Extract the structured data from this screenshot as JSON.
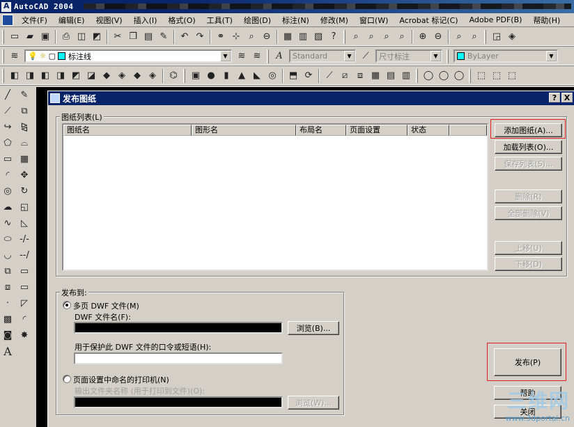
{
  "app": {
    "title": "AutoCAD 2004"
  },
  "menu": [
    "文件(F)",
    "编辑(E)",
    "视图(V)",
    "插入(I)",
    "格式(O)",
    "工具(T)",
    "绘图(D)",
    "标注(N)",
    "修改(M)",
    "窗口(W)",
    "Acrobat 标记(C)",
    "Adobe PDF(B)",
    "帮助(H)"
  ],
  "toolbar2": {
    "layer_value": "标注线",
    "text_style": "Standard",
    "dim_style": "尺寸标注",
    "color": "ByLayer",
    "color_swatch": "#00ffff"
  },
  "dialog": {
    "title": "发布图纸",
    "help_btn": "?",
    "close_btn": "X",
    "list_group_label": "图纸列表(L)",
    "columns": [
      "图纸名",
      "图形名",
      "布局名",
      "页面设置",
      "状态"
    ],
    "buttons": {
      "add": "添加图纸(A)...",
      "load": "加载列表(O)...",
      "save": "保存列表(S)...",
      "remove": "删除(R)",
      "remove_all": "全部删除(V)",
      "move_up": "上移(U)",
      "move_down": "下移(D)",
      "publish": "发布(P)",
      "help": "帮助",
      "close": "关闭"
    },
    "publish_to": {
      "label": "发布到:",
      "option_multi": "多页 DWF 文件(M)",
      "dwf_filename_label": "DWF 文件名(F):",
      "browse1": "浏览(B)...",
      "password_label": "用于保护此 DWF 文件的口令或短语(H):",
      "option_plotter": "页面设置中命名的打印机(N)",
      "output_folder_label": "输出文件夹名称 (用于打印到文件)(O):",
      "browse2": "浏览(W)..."
    }
  },
  "watermark": {
    "big": "三维网",
    "small": "www.3dportal.cn"
  }
}
